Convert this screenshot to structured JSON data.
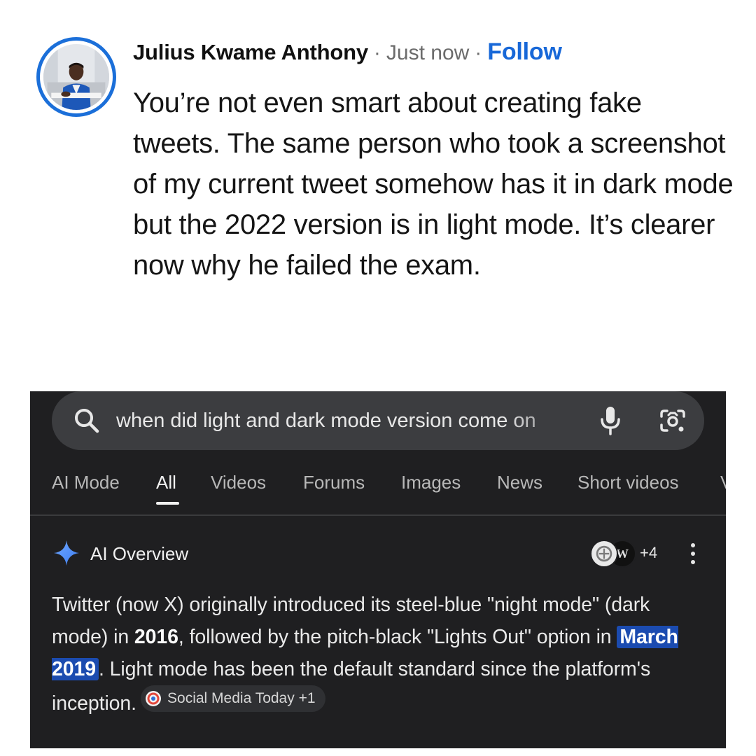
{
  "comment": {
    "author": "Julius Kwame Anthony",
    "separator": "·",
    "time": "Just now",
    "follow_label": "Follow",
    "text": "You’re not even smart about creating fake tweets. The same person who took a screenshot of my current tweet somehow has it in dark mode but the 2022 version is in light mode. It’s clearer now why he failed the exam."
  },
  "search": {
    "query": "when did light and dark mode version come on",
    "tabs": [
      {
        "label": "AI Mode",
        "active": false
      },
      {
        "label": "All",
        "active": true
      },
      {
        "label": "Videos",
        "active": false
      },
      {
        "label": "Forums",
        "active": false
      },
      {
        "label": "Images",
        "active": false
      },
      {
        "label": "News",
        "active": false
      },
      {
        "label": "Short videos",
        "active": false
      },
      {
        "label": "V",
        "active": false
      }
    ]
  },
  "ai_overview": {
    "title": "AI Overview",
    "source_letter": "W",
    "more_sources": "+4",
    "text_part1": "Twitter (now X) originally introduced its steel-blue \"night mode\" (dark mode) in ",
    "bold_year": "2016",
    "text_part2": ", followed by the pitch-black \"Lights Out\" option in ",
    "highlight": "March 2019",
    "text_part3": ". Light mode has been the default standard since the platform's inception.",
    "chip_label": "Social Media Today +1"
  },
  "colors": {
    "follow": "#1868d8",
    "avatar_ring": "#1b6fd9",
    "dark_bg": "#1f1f21",
    "search_bar": "#3c3d40",
    "highlight": "#1b4bb0"
  },
  "icons": [
    "search-icon",
    "mic-icon",
    "google-lens-icon",
    "sparkle-icon",
    "kebab-menu-icon",
    "source-favicon-icon"
  ]
}
